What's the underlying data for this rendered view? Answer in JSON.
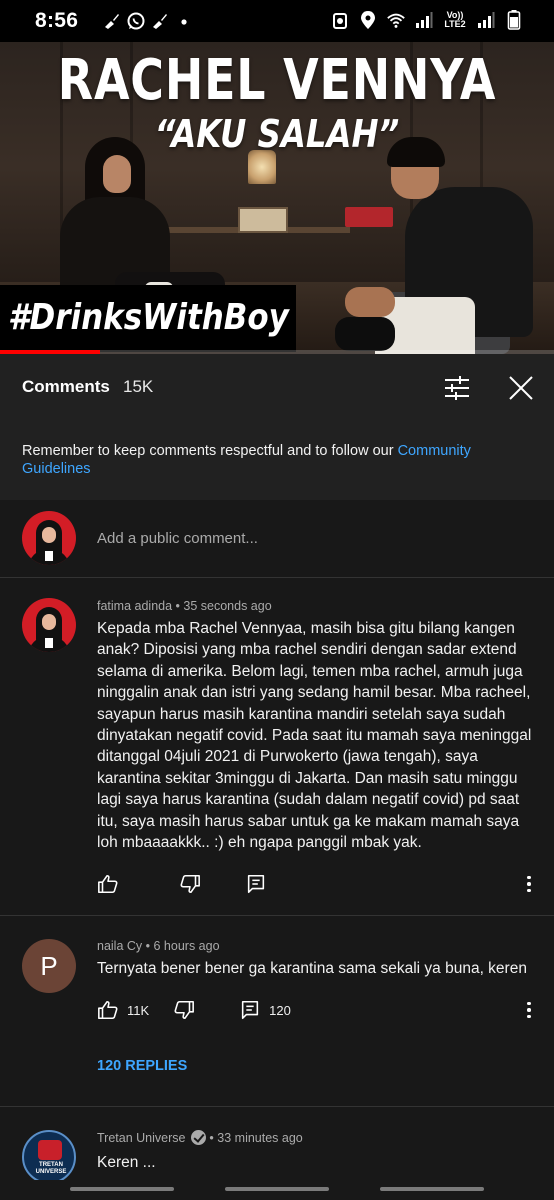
{
  "status_bar": {
    "time": "8:56",
    "left_icons": [
      "broom-icon",
      "whatsapp-icon",
      "broom-icon",
      "dot-icon"
    ],
    "right_icons": [
      "alarm-icon",
      "location-icon",
      "wifi-icon",
      "signal-icon",
      "volte-icon",
      "signal-icon",
      "battery-icon"
    ],
    "volte_line1": "Vo))",
    "volte_line2": "LTE2"
  },
  "video": {
    "title_line1": "RACHEL VENNYA",
    "title_line2": "“AKU SALAH”",
    "hashtag": "#DrinksWithBoy",
    "progress": 0.18,
    "progress_color": "#ff0000"
  },
  "comments_panel": {
    "title": "Comments",
    "count": "15K",
    "guidelines_text": "Remember to keep comments respectful and to follow our ",
    "guidelines_link": "Community Guidelines",
    "add_comment_placeholder": "Add a public comment...",
    "link_color": "#3ea6ff"
  },
  "comments": [
    {
      "author": "fatima adinda",
      "time": "35 seconds ago",
      "text": "Kepada mba Rachel Vennyaa, masih bisa gitu bilang kangen anak? Diposisi yang mba rachel sendiri dengan sadar extend selama di amerika. Belom lagi, temen mba rachel, armuh juga ninggalin anak dan istri yang sedang hamil besar. Mba racheel, sayapun harus masih karantina mandiri setelah saya sudah dinyatakan negatif covid. Pada saat itu mamah saya meninggal ditanggal 04juli 2021 di Purwokerto (jawa tengah), saya karantina sekitar 3minggu di Jakarta. Dan masih satu minggu lagi saya harus karantina (sudah dalam negatif covid) pd saat itu, saya masih harus sabar untuk ga ke makam mamah saya loh mbaaaakkk.. :) eh ngapa panggil mbak yak.",
      "likes": "",
      "reply_count": ""
    },
    {
      "author": "naila Cy",
      "avatar_letter": "P",
      "time": "6 hours ago",
      "text": "Ternyata bener bener ga karantina sama sekali ya buna, keren",
      "likes": "11K",
      "reply_count": "120",
      "replies_link": "120 REPLIES"
    },
    {
      "author": "Tretan Universe",
      "avatar_text": "TRETAN UNIVERSE",
      "time": "33 minutes ago",
      "text": "Keren ..."
    }
  ]
}
